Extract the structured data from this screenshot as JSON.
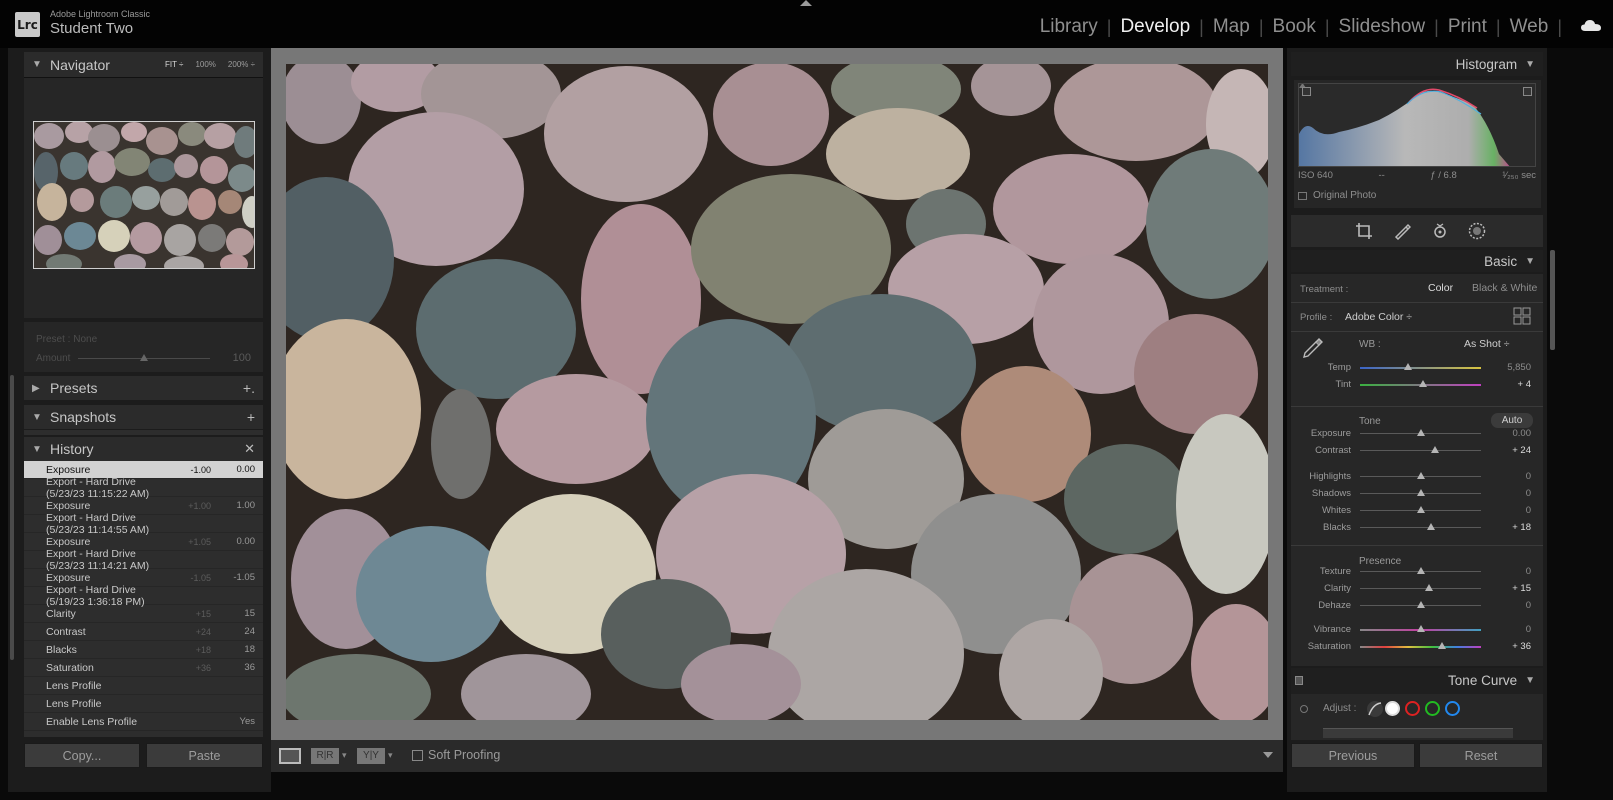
{
  "app": {
    "logo": "Lrc",
    "name": "Adobe Lightroom Classic",
    "user": "Student Two"
  },
  "modules": [
    "Library",
    "Develop",
    "Map",
    "Book",
    "Slideshow",
    "Print",
    "Web"
  ],
  "active_module": "Develop",
  "navigator": {
    "title": "Navigator",
    "fit": "FIT ÷",
    "z1": "100%",
    "z2": "200% ÷"
  },
  "preset": {
    "label": "Preset : None",
    "amount_label": "Amount",
    "amount_value": "100",
    "amount_level": 0.5
  },
  "presets_title": "Presets",
  "snapshots_title": "Snapshots",
  "history": {
    "title": "History",
    "items": [
      {
        "label": "Exposure",
        "a": "-1.00",
        "b": "0.00"
      },
      {
        "label": "Export - Hard Drive (5/23/23 11:15:22 AM)",
        "a": "",
        "b": ""
      },
      {
        "label": "Exposure",
        "a": "+1.00",
        "b": "1.00"
      },
      {
        "label": "Export - Hard Drive (5/23/23 11:14:55 AM)",
        "a": "",
        "b": ""
      },
      {
        "label": "Exposure",
        "a": "+1.05",
        "b": "0.00"
      },
      {
        "label": "Export - Hard Drive (5/23/23 11:14:21 AM)",
        "a": "",
        "b": ""
      },
      {
        "label": "Exposure",
        "a": "-1.05",
        "b": "-1.05"
      },
      {
        "label": "Export - Hard Drive (5/19/23 1:36:18 PM)",
        "a": "",
        "b": ""
      },
      {
        "label": "Clarity",
        "a": "+15",
        "b": "15"
      },
      {
        "label": "Contrast",
        "a": "+24",
        "b": "24"
      },
      {
        "label": "Blacks",
        "a": "+18",
        "b": "18"
      },
      {
        "label": "Saturation",
        "a": "+36",
        "b": "36"
      },
      {
        "label": "Lens Profile",
        "a": "",
        "b": ""
      },
      {
        "label": "Lens Profile",
        "a": "",
        "b": ""
      },
      {
        "label": "Enable Lens Profile",
        "a": "",
        "b": "Yes"
      }
    ]
  },
  "left_buttons": {
    "copy": "Copy...",
    "paste": "Paste"
  },
  "toolbar": {
    "soft_proofing": "Soft Proofing"
  },
  "histogram": {
    "title": "Histogram",
    "iso": "ISO 640",
    "focal": "--",
    "aperture": "ƒ / 6.8",
    "shutter": "¹⁄₂₅₀ sec",
    "original_photo": "Original Photo"
  },
  "basic": {
    "title": "Basic",
    "treatment_label": "Treatment :",
    "treatment_color": "Color",
    "treatment_bw": "Black & White",
    "profile_label": "Profile :",
    "profile_value": "Adobe Color ÷",
    "wb_label": "WB :",
    "wb_value": "As Shot ÷",
    "tone_label": "Tone",
    "auto_label": "Auto",
    "presence_label": "Presence",
    "sliders": {
      "temp": {
        "name": "Temp",
        "value": "5,850",
        "pos": 0.4
      },
      "tint": {
        "name": "Tint",
        "value": "+ 4",
        "pos": 0.52
      },
      "exposure": {
        "name": "Exposure",
        "value": "0.00",
        "pos": 0.5
      },
      "contrast": {
        "name": "Contrast",
        "value": "+ 24",
        "pos": 0.62
      },
      "highlights": {
        "name": "Highlights",
        "value": "0",
        "pos": 0.5
      },
      "shadows": {
        "name": "Shadows",
        "value": "0",
        "pos": 0.5
      },
      "whites": {
        "name": "Whites",
        "value": "0",
        "pos": 0.5
      },
      "blacks": {
        "name": "Blacks",
        "value": "+ 18",
        "pos": 0.59
      },
      "texture": {
        "name": "Texture",
        "value": "0",
        "pos": 0.5
      },
      "clarity": {
        "name": "Clarity",
        "value": "+ 15",
        "pos": 0.57
      },
      "dehaze": {
        "name": "Dehaze",
        "value": "0",
        "pos": 0.5
      },
      "vibrance": {
        "name": "Vibrance",
        "value": "0",
        "pos": 0.5
      },
      "saturation": {
        "name": "Saturation",
        "value": "+ 36",
        "pos": 0.68
      }
    }
  },
  "tone_curve": {
    "title": "Tone Curve",
    "adjust_label": "Adjust :"
  },
  "right_buttons": {
    "previous": "Previous",
    "reset": "Reset"
  }
}
